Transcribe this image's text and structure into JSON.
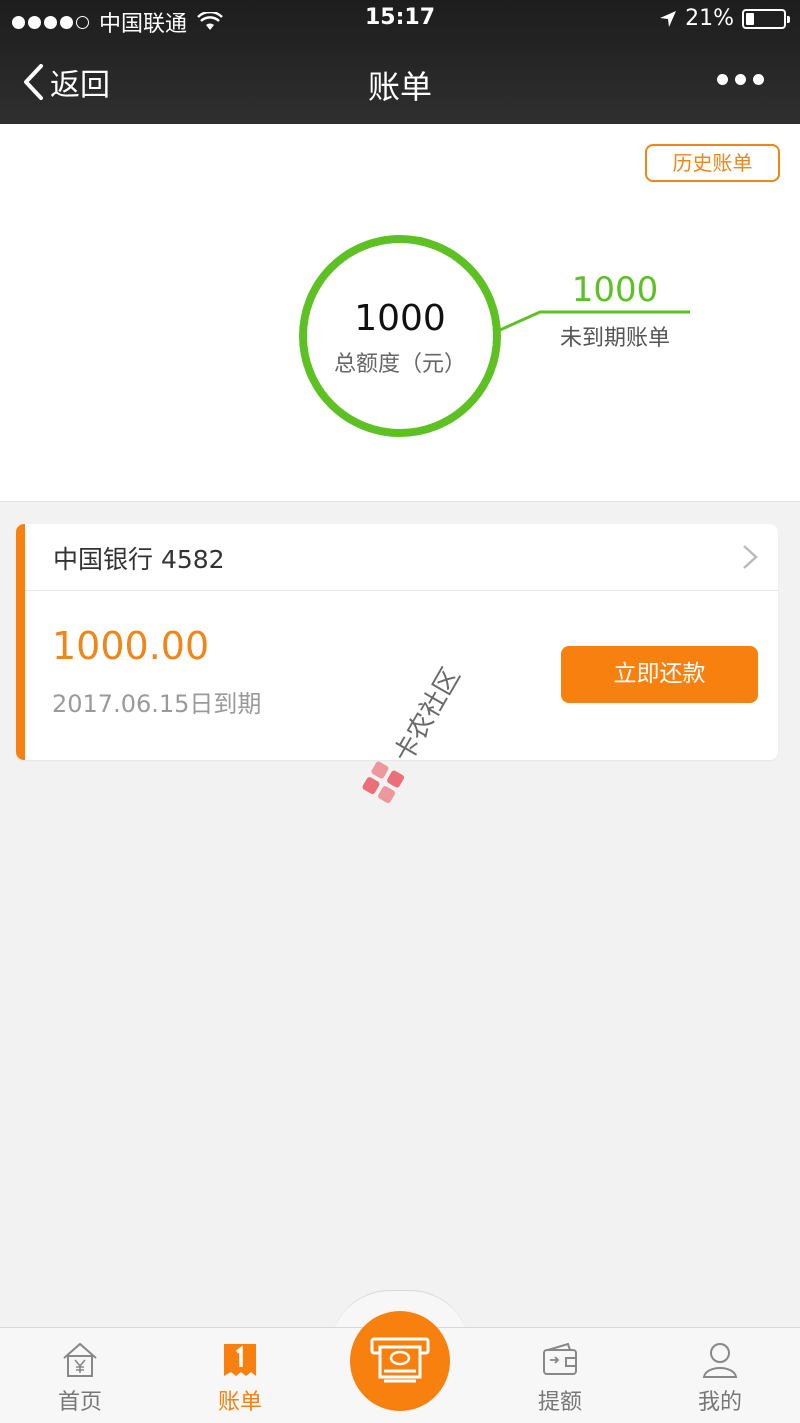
{
  "status_bar": {
    "carrier": "中国联通",
    "time": "15:17",
    "battery_percent": "21%",
    "battery_level": 0.21
  },
  "nav": {
    "back_label": "返回",
    "title": "账单"
  },
  "summary": {
    "history_button": "历史账单",
    "total_amount": "1000",
    "total_label": "总额度（元）",
    "unpaid_amount": "1000",
    "unpaid_label": "未到期账单",
    "ring_color": "#5ec123"
  },
  "bill": {
    "bank": "中国银行 4582",
    "amount": "1000.00",
    "due_text": "2017.06.15日到期",
    "repay_button": "立即还款",
    "accent_color": "#f7800f"
  },
  "watermark": {
    "text": "卡农社区"
  },
  "tabbar": {
    "items": [
      {
        "label": "首页",
        "icon": "home-yen-icon"
      },
      {
        "label": "账单",
        "icon": "bill-icon"
      },
      {
        "label": "",
        "icon": "cash-withdraw-icon"
      },
      {
        "label": "提额",
        "icon": "wallet-icon"
      },
      {
        "label": "我的",
        "icon": "user-icon"
      }
    ]
  }
}
